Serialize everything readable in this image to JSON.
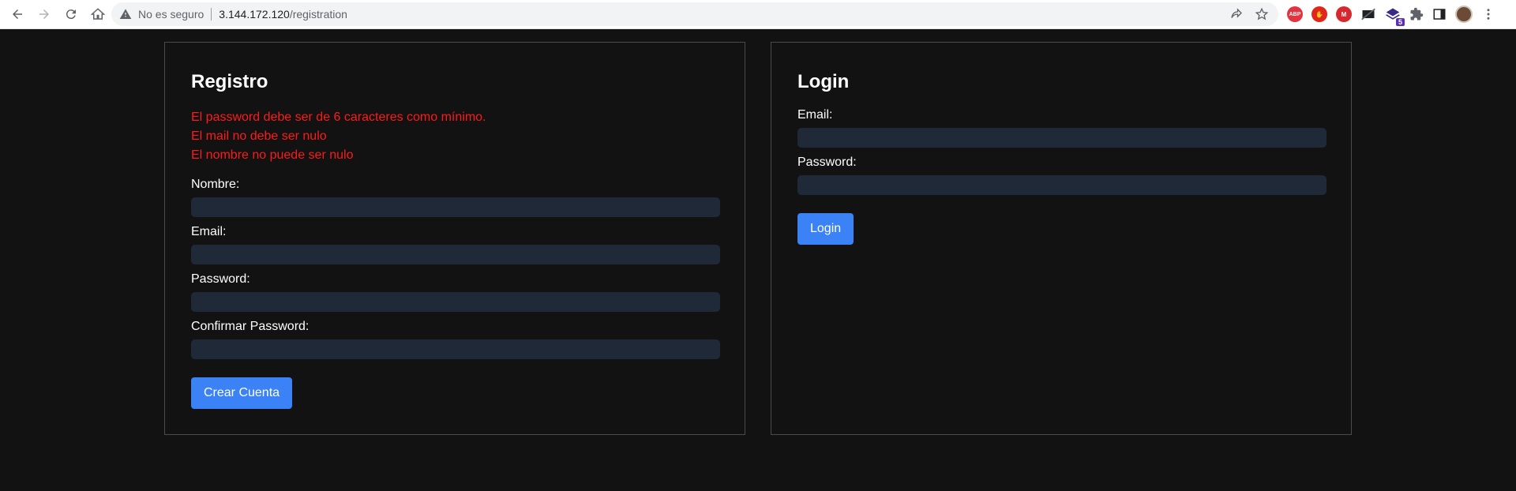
{
  "browser": {
    "security_text": "No es seguro",
    "url_host": "3.144.172.120",
    "url_path": "/registration",
    "extensions": {
      "abp_label": "ABP",
      "mega_label": "M",
      "stack_badge": "5"
    }
  },
  "register": {
    "title": "Registro",
    "errors": [
      "El password debe ser de 6 caracteres como mínimo.",
      "El mail no debe ser nulo",
      "El nombre no puede ser nulo"
    ],
    "name_label": "Nombre:",
    "name_value": "",
    "email_label": "Email:",
    "email_value": "",
    "password_label": "Password:",
    "password_value": "",
    "confirm_label": "Confirmar Password:",
    "confirm_value": "",
    "submit_label": "Crear Cuenta"
  },
  "login": {
    "title": "Login",
    "email_label": "Email:",
    "email_value": "",
    "password_label": "Password:",
    "password_value": "",
    "submit_label": "Login"
  },
  "colors": {
    "background": "#121212",
    "input_bg": "#1f2937",
    "error": "#ff1a1a",
    "button": "#3b82f6",
    "panel_border": "#4a4a4a"
  }
}
